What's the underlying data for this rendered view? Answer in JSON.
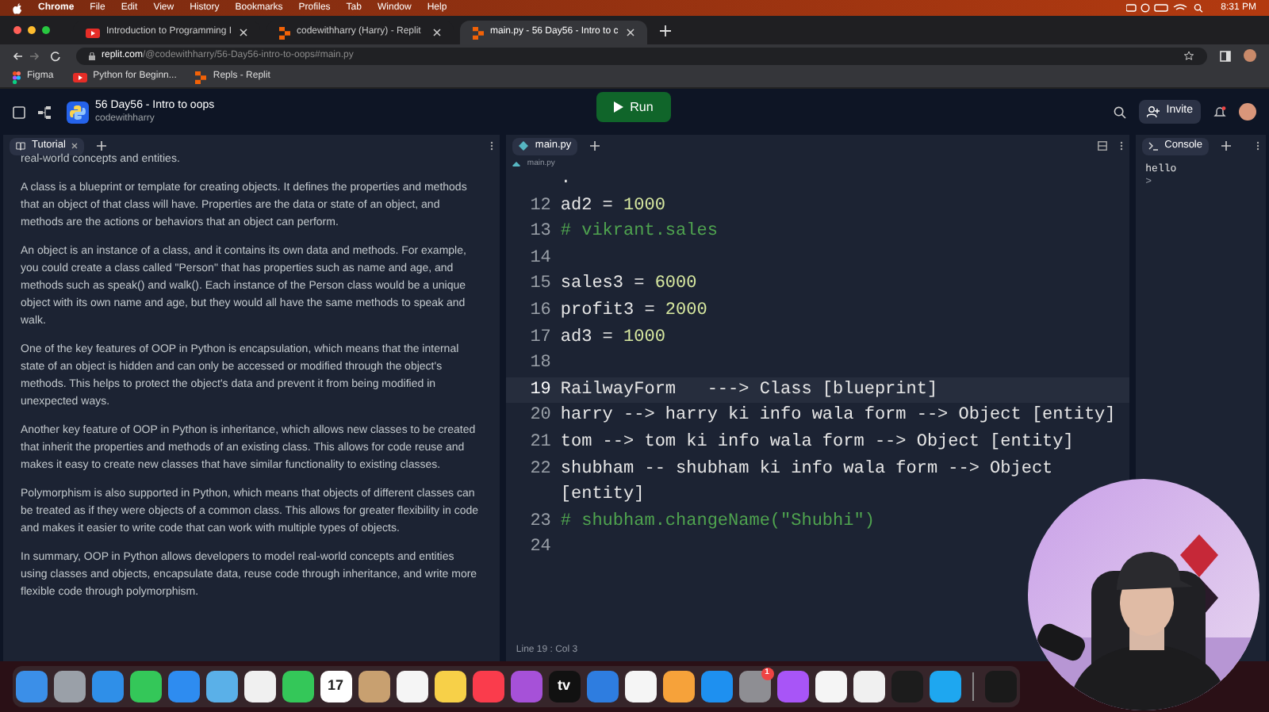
{
  "menu_bar": {
    "items": [
      "Chrome",
      "File",
      "Edit",
      "View",
      "History",
      "Bookmarks",
      "Profiles",
      "Tab",
      "Window",
      "Help"
    ],
    "time": "8:31 PM"
  },
  "browser": {
    "tabs": [
      {
        "title": "Introduction to Programming I",
        "selected": false,
        "kind": "video"
      },
      {
        "title": "codewithharry (Harry) - Replit",
        "selected": false,
        "kind": "replit"
      },
      {
        "title": "main.py - 56 Day56 - Intro to c",
        "selected": true,
        "kind": "replit"
      }
    ],
    "url_host": "replit.com",
    "url_path": "/@codewithharry/56-Day56-intro-to-oops#main.py",
    "bookmarks": [
      {
        "label": "Figma",
        "kind": "figma"
      },
      {
        "label": "Python for Beginn...",
        "kind": "video"
      },
      {
        "label": "Repls - Replit",
        "kind": "replit"
      }
    ]
  },
  "repl": {
    "title": "56 Day56 - Intro to oops",
    "owner": "codewithharry",
    "run_label": "Run",
    "invite_label": "Invite"
  },
  "tutorial": {
    "tab": "Tutorial",
    "paragraphs": [
      "real-world concepts and entities.",
      "A class is a blueprint or template for creating objects. It defines the properties and methods that an object of that class will have. Properties are the data or state of an object, and methods are the actions or behaviors that an object can perform.",
      "An object is an instance of a class, and it contains its own data and methods. For example, you could create a class called \"Person\" that has properties such as name and age, and methods such as speak() and walk(). Each instance of the Person class would be a unique object with its own name and age, but they would all have the same methods to speak and walk.",
      "One of the key features of OOP in Python is encapsulation, which means that the internal state of an object is hidden and can only be accessed or modified through the object's methods. This helps to protect the object's data and prevent it from being modified in unexpected ways.",
      "Another key feature of OOP in Python is inheritance, which allows new classes to be created that inherit the properties and methods of an existing class. This allows for code reuse and makes it easy to create new classes that have similar functionality to existing classes.",
      "Polymorphism is also supported in Python, which means that objects of different classes can be treated as if they were objects of a common class. This allows for greater flexibility in code and makes it easier to write code that can work with multiple types of objects.",
      "In summary, OOP in Python allows developers to model real-world concepts and entities using classes and objects, encapsulate data, reuse code through inheritance, and write more flexible code through polymorphism."
    ]
  },
  "editor": {
    "tab": "main.py",
    "breadcrumb": "main.py",
    "status": "Line 19 : Col 3",
    "lines": [
      {
        "segments": [
          {
            "t": ".",
            "kind": "plain"
          }
        ]
      },
      {
        "number": "12",
        "segments": [
          {
            "t": "ad2 = ",
            "kind": "plain"
          },
          {
            "t": "1000",
            "kind": "number"
          }
        ],
        "active": false
      },
      {
        "number": "13",
        "segments": [
          {
            "t": "# vikrant.sales",
            "kind": "comment"
          }
        ],
        "active": false
      },
      {
        "number": "14",
        "active": false
      },
      {
        "number": "15",
        "segments": [
          {
            "t": "sales3 = ",
            "kind": "plain"
          },
          {
            "t": "6000",
            "kind": "number"
          }
        ],
        "active": false
      },
      {
        "number": "16",
        "segments": [
          {
            "t": "profit3 = ",
            "kind": "plain"
          },
          {
            "t": "2000",
            "kind": "number"
          }
        ],
        "active": false
      },
      {
        "number": "17",
        "segments": [
          {
            "t": "ad3 = ",
            "kind": "plain"
          },
          {
            "t": "1000",
            "kind": "number"
          }
        ],
        "active": false
      },
      {
        "number": "18",
        "active": false
      },
      {
        "number": "19",
        "segments": [
          {
            "t": "RailwayForm   ---> Class [blueprint]",
            "kind": "plain"
          }
        ],
        "active": true
      },
      {
        "number": "20",
        "segments": [
          {
            "t": "harry --> harry ki info wala form --> Object [entity]",
            "kind": "plain"
          }
        ],
        "active": false
      },
      {
        "number": "21",
        "segments": [
          {
            "t": "tom --> tom ki info wala form --> Object [entity]",
            "kind": "plain"
          }
        ],
        "active": false
      },
      {
        "number": "22",
        "segments": [
          {
            "t": "shubham -- shubham ki info wala form --> Object [entity]",
            "kind": "plain"
          }
        ],
        "active": false
      },
      {
        "number": "23",
        "segments": [
          {
            "t": "# shubham.changeName(\"Shubhi\")",
            "kind": "comment"
          }
        ],
        "active": false
      },
      {
        "number": "24",
        "active": false
      }
    ]
  },
  "console": {
    "tab": "Console",
    "output": "hello",
    "prompt": ">"
  },
  "dock": [
    {
      "color": "#3b8fe8"
    },
    {
      "color": "#9aa0a8"
    },
    {
      "color": "#2f8fe8"
    },
    {
      "color": "#34c759"
    },
    {
      "color": "#2e8cf0"
    },
    {
      "color": "#5ab0e8"
    },
    {
      "color": "#f0f0f0"
    },
    {
      "color": "#34c759"
    },
    {
      "color": "#ffffff",
      "label": "17"
    },
    {
      "color": "#c8a070"
    },
    {
      "color": "#f5f5f5"
    },
    {
      "color": "#f7d048"
    },
    {
      "color": "#fa3c4c"
    },
    {
      "color": "#a651d8"
    },
    {
      "color": "#111111",
      "label": "tv"
    },
    {
      "color": "#2e7de0"
    },
    {
      "color": "#f5f5f5"
    },
    {
      "color": "#f6a23a"
    },
    {
      "color": "#1e90f0"
    },
    {
      "color": "#8e8e93",
      "badge": "1"
    },
    {
      "color": "#a855f7"
    },
    {
      "color": "#f5f5f5"
    },
    {
      "color": "#f0f0f0"
    },
    {
      "color": "#1c1c1c"
    },
    {
      "color": "#1ea7f0"
    },
    {
      "color": "#1a1a1a",
      "separator_before": true
    }
  ]
}
